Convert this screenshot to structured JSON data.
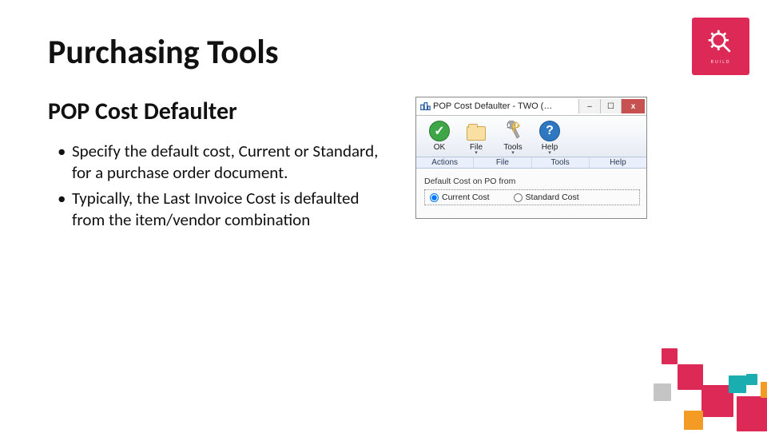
{
  "slide": {
    "title": "Purchasing Tools",
    "subtitle": "POP Cost Defaulter",
    "bullets": [
      "Specify the default cost, Current or Standard, for a purchase order document.",
      "Typically, the Last Invoice Cost is defaulted from the item/vendor combination"
    ]
  },
  "logo": {
    "brand": "BUILD"
  },
  "window": {
    "title": "POP Cost Defaulter  -  TWO (…",
    "buttons": {
      "minimize": "–",
      "maximize": "☐",
      "close": "x"
    },
    "toolbar": {
      "ok": "OK",
      "file": "File",
      "tools": "Tools",
      "help": "Help"
    },
    "groups": {
      "actions": "Actions",
      "file": "File",
      "tools": "Tools",
      "help": "Help"
    },
    "form": {
      "groupLabel": "Default Cost on PO from",
      "option1": "Current Cost",
      "option2": "Standard Cost"
    }
  },
  "deco": {
    "colors": {
      "pink": "#dd2955",
      "teal": "#1aaeb0",
      "orange": "#f39b24",
      "gray": "#9f9f9f"
    }
  }
}
